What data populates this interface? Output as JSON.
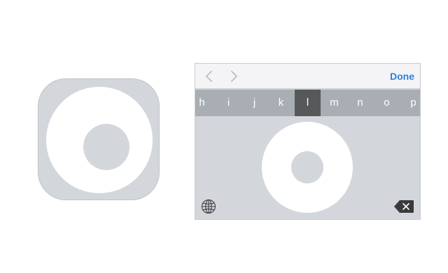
{
  "toolbar": {
    "done_label": "Done",
    "prev_icon": "chevron-left-icon",
    "next_icon": "chevron-right-icon"
  },
  "letters": [
    "h",
    "i",
    "j",
    "k",
    "l",
    "m",
    "n",
    "o",
    "p"
  ],
  "selected_letter": "l",
  "icons": {
    "globe": "globe-icon",
    "delete": "backspace-icon"
  },
  "colors": {
    "accent": "#2f7fdd",
    "panel": "#d3d7db",
    "strip": "#a9aeb4",
    "selected": "#565859"
  }
}
